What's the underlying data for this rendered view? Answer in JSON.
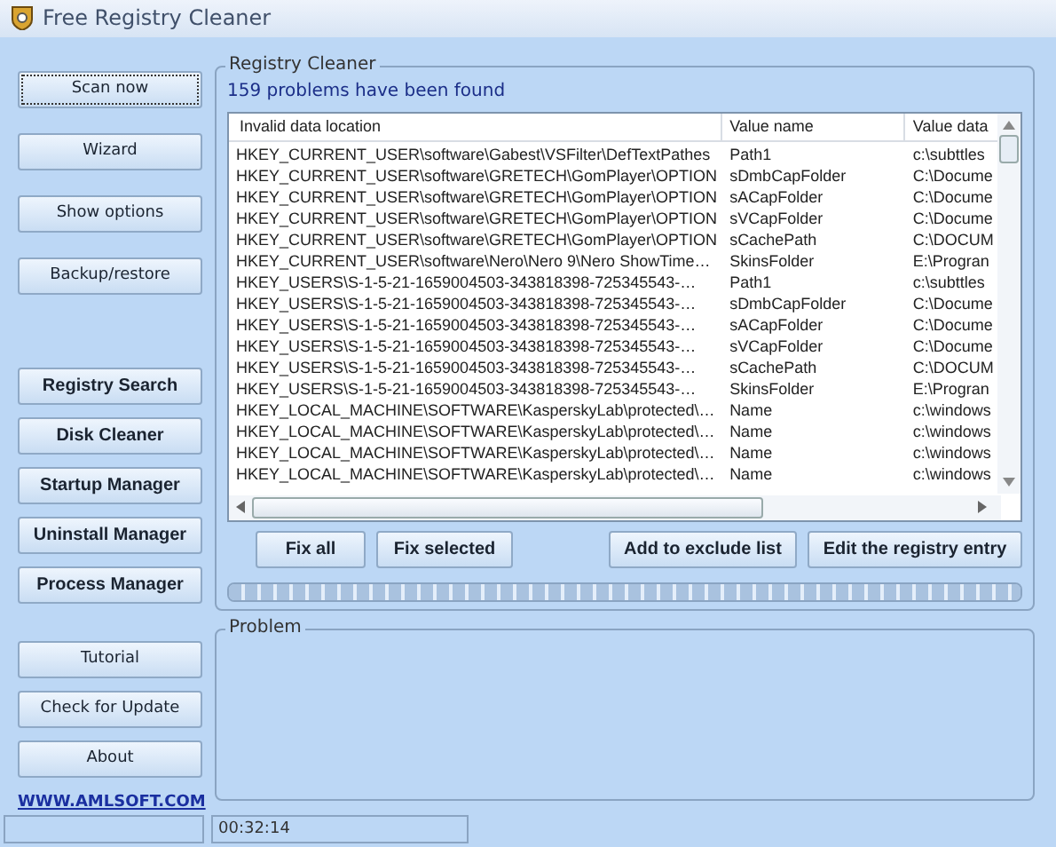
{
  "window": {
    "title": "Free Registry Cleaner"
  },
  "sidebar": {
    "buttons": [
      {
        "label": "Scan now",
        "kind": "plain",
        "focused": true
      },
      {
        "label": "Wizard",
        "kind": "plain",
        "focused": false
      },
      {
        "label": "Show options",
        "kind": "plain",
        "focused": false
      },
      {
        "label": "Backup/restore",
        "kind": "plain",
        "focused": false
      },
      {
        "label": "Registry Search",
        "kind": "tool",
        "focused": false
      },
      {
        "label": "Disk Cleaner",
        "kind": "tool",
        "focused": false
      },
      {
        "label": "Startup Manager",
        "kind": "tool",
        "focused": false
      },
      {
        "label": "Uninstall Manager",
        "kind": "tool",
        "focused": false
      },
      {
        "label": "Process Manager",
        "kind": "tool",
        "focused": false
      },
      {
        "label": "Tutorial",
        "kind": "help",
        "focused": false
      },
      {
        "label": "Check for Update",
        "kind": "help",
        "focused": false
      },
      {
        "label": "About",
        "kind": "help",
        "focused": false
      }
    ],
    "link": "WWW.AMLSOFT.COM"
  },
  "registry_cleaner": {
    "title": "Registry Cleaner",
    "summary": "159 problems have been found",
    "table": {
      "columns": [
        "Invalid data location",
        "Value name",
        "Value data"
      ],
      "rows": [
        [
          "HKEY_CURRENT_USER\\software\\Gabest\\VSFilter\\DefTextPathes",
          "Path1",
          "c:\\subttles"
        ],
        [
          "HKEY_CURRENT_USER\\software\\GRETECH\\GomPlayer\\OPTION",
          "sDmbCapFolder",
          "C:\\Docume"
        ],
        [
          "HKEY_CURRENT_USER\\software\\GRETECH\\GomPlayer\\OPTION",
          "sACapFolder",
          "C:\\Docume"
        ],
        [
          "HKEY_CURRENT_USER\\software\\GRETECH\\GomPlayer\\OPTION",
          "sVCapFolder",
          "C:\\Docume"
        ],
        [
          "HKEY_CURRENT_USER\\software\\GRETECH\\GomPlayer\\OPTION",
          "sCachePath",
          "C:\\DOCUM"
        ],
        [
          "HKEY_CURRENT_USER\\software\\Nero\\Nero 9\\Nero ShowTime…",
          "SkinsFolder",
          "E:\\Progran"
        ],
        [
          "HKEY_USERS\\S-1-5-21-1659004503-343818398-725345543-…",
          "Path1",
          "c:\\subttles"
        ],
        [
          "HKEY_USERS\\S-1-5-21-1659004503-343818398-725345543-…",
          "sDmbCapFolder",
          "C:\\Docume"
        ],
        [
          "HKEY_USERS\\S-1-5-21-1659004503-343818398-725345543-…",
          "sACapFolder",
          "C:\\Docume"
        ],
        [
          "HKEY_USERS\\S-1-5-21-1659004503-343818398-725345543-…",
          "sVCapFolder",
          "C:\\Docume"
        ],
        [
          "HKEY_USERS\\S-1-5-21-1659004503-343818398-725345543-…",
          "sCachePath",
          "C:\\DOCUM"
        ],
        [
          "HKEY_USERS\\S-1-5-21-1659004503-343818398-725345543-…",
          "SkinsFolder",
          "E:\\Progran"
        ],
        [
          "HKEY_LOCAL_MACHINE\\SOFTWARE\\KasperskyLab\\protected\\…",
          "Name",
          "c:\\windows"
        ],
        [
          "HKEY_LOCAL_MACHINE\\SOFTWARE\\KasperskyLab\\protected\\…",
          "Name",
          "c:\\windows"
        ],
        [
          "HKEY_LOCAL_MACHINE\\SOFTWARE\\KasperskyLab\\protected\\…",
          "Name",
          "c:\\windows"
        ],
        [
          "HKEY_LOCAL_MACHINE\\SOFTWARE\\KasperskyLab\\protected\\…",
          "Name",
          "c:\\windows"
        ]
      ]
    },
    "buttons": [
      "Fix all",
      "Fix selected",
      "Add to exclude list",
      "Edit the registry entry"
    ],
    "progress": {
      "level": 1
    }
  },
  "problem": {
    "title": "Problem"
  },
  "status_bar": {
    "time": "00:32:14"
  }
}
